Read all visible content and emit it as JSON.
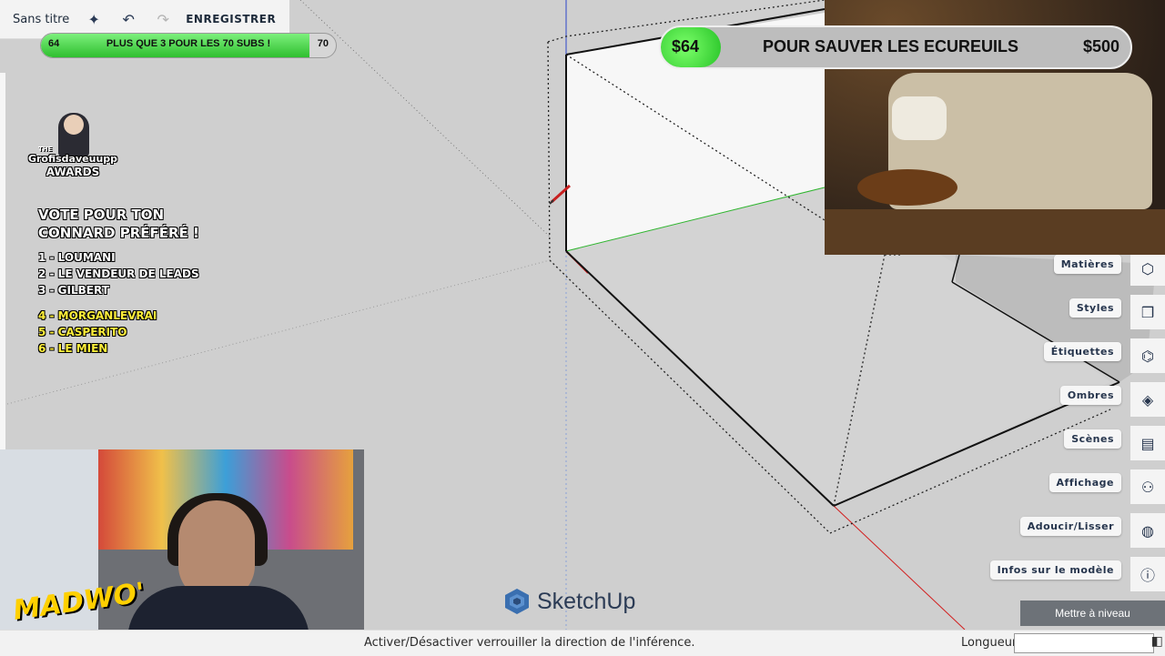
{
  "toolbar": {
    "title": "Sans titre",
    "save_label": "ENREGISTRER",
    "icons": [
      "sparkle-icon",
      "undo-icon",
      "redo-icon"
    ]
  },
  "sub_goal": {
    "current": "64",
    "target": "70",
    "text": "PLUS QUE 3 POUR LES 70 SUBS !",
    "progress": 0.91
  },
  "donation": {
    "current": "$64",
    "label": "POUR SAUVER LES ECUREUILS",
    "goal": "$500",
    "progress": 0.128
  },
  "awards": {
    "the": "THE",
    "brand": "Grofisdaveuupp",
    "awards": "AWARDS",
    "heading_1": "VOTE POUR TON",
    "heading_2": "CONNARD PRÉFÉRÉ !",
    "group_1": [
      "1 - LOUMANI",
      "2 - LE VENDEUR DE LEADS",
      "3 - GILBERT"
    ],
    "group_2": [
      "4 - MORGANLEVRAI",
      "5 - CASPERITO",
      "6 - LE MIEN"
    ]
  },
  "overlay": {
    "madwo": "MADWO'"
  },
  "panel": {
    "items": [
      {
        "label": "Matières",
        "icon": "cube-icon"
      },
      {
        "label": "Styles",
        "icon": "styles-cube-icon"
      },
      {
        "label": "Étiquettes",
        "icon": "tag-icon"
      },
      {
        "label": "Ombres",
        "icon": "shadow-icon"
      },
      {
        "label": "Scènes",
        "icon": "clapperboard-icon"
      },
      {
        "label": "Affichage",
        "icon": "glasses-icon"
      },
      {
        "label": "Adoucir/Lisser",
        "icon": "sphere-icon"
      },
      {
        "label": "Infos sur le modèle",
        "icon": "info-icon"
      }
    ],
    "upgrade_label": "Mettre à niveau"
  },
  "brand": {
    "name": "SketchUp"
  },
  "status": {
    "message": "Activer/Désactiver verrouiller la direction de l'inférence.",
    "length_label": "Longueur",
    "length_value": ""
  },
  "colors": {
    "axis_red": "#d21e1e",
    "axis_green": "#2fb52f",
    "axis_blue": "#2b46c8",
    "highlight_yellow": "#ffef3a",
    "goal_green": "#3fd33f"
  }
}
